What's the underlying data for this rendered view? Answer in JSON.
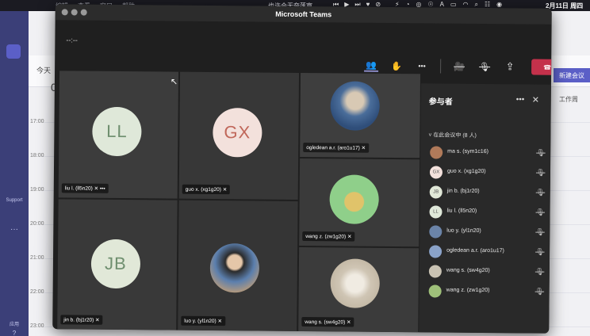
{
  "menubar": {
    "menus": [
      "编辑",
      "查看",
      "窗口",
      "帮助"
    ],
    "now_playing": "也许会无奈落寞",
    "media_controls": [
      "⏮",
      "▶",
      "⏭",
      "♥",
      "⊘"
    ],
    "status_icons": [
      "⚡",
      "◔",
      "◎",
      "☉",
      "A",
      "▭",
      "◠",
      "⌕",
      "☷",
      "◉"
    ],
    "date": "2月11日 周四"
  },
  "background_app": {
    "today_label": "今天",
    "day_number": "0",
    "new_meeting": "新建会议",
    "work_week": "工作周",
    "times": [
      "17:00",
      "18:00",
      "19:00",
      "20:00",
      "21:00",
      "22:00",
      "23:00"
    ],
    "rail_labels": [
      "",
      "",
      "",
      "Support",
      "···",
      "应用",
      "?"
    ]
  },
  "window": {
    "title": "Microsoft Teams",
    "timer": "--:--",
    "toolbar": {
      "participants_icon": "👥",
      "raise_hand_icon": "✋",
      "more_icon": "•••",
      "camera_off_icon": "🎥",
      "mic_off_icon": "🎙",
      "share_icon": "⇪",
      "leave_label": "退出"
    }
  },
  "tiles": [
    {
      "initials": "LL",
      "name": "liu l. (ll5n20)",
      "more": "•••",
      "bg": "#dfe8d9",
      "fg": "#6f8f6f"
    },
    {
      "initials": "GX",
      "name": "guo x. (xg1g20)",
      "bg": "#f3e1dc",
      "fg": "#c0675a"
    },
    {
      "initials": "",
      "name": "ogledean a.r. (aro1u17)"
    },
    {
      "initials": "",
      "name": "wang z. (zw1g20)"
    },
    {
      "initials": "JB",
      "name": "jin b. (bj1r20)",
      "bg": "#e1e8d8",
      "fg": "#6f8f6f"
    },
    {
      "initials": "",
      "name": "luo y. (yl1n20)"
    },
    {
      "initials": "",
      "name": "wang s. (sw4g20)"
    }
  ],
  "participants": {
    "title": "参与者",
    "more": "•••",
    "close": "✕",
    "section": "˅ 在此会议中 (8 人)",
    "list": [
      {
        "name": "ma s. (sym1c16)",
        "initials": "",
        "color": "#b07a5a"
      },
      {
        "name": "guo x. (xg1g20)",
        "initials": "GX",
        "color": "#f3e1dc"
      },
      {
        "name": "jin b. (bj1r20)",
        "initials": "JB",
        "color": "#e1e8d8"
      },
      {
        "name": "liu l. (ll5n20)",
        "initials": "LL",
        "color": "#dfe8d9"
      },
      {
        "name": "luo y. (yl1n20)",
        "initials": "",
        "color": "#6b84a8"
      },
      {
        "name": "ogledean a.r. (aro1u17)",
        "initials": "",
        "color": "#8aa2c8"
      },
      {
        "name": "wang s. (sw4g20)",
        "initials": "",
        "color": "#c9c2b3"
      },
      {
        "name": "wang z. (zw1g20)",
        "initials": "",
        "color": "#9fc07a"
      }
    ]
  }
}
